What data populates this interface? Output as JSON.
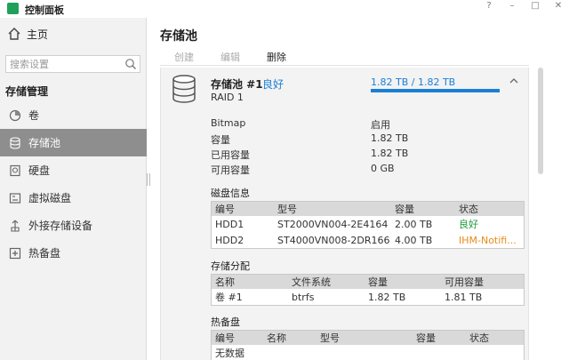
{
  "window": {
    "title": "控制面板",
    "help": "?",
    "minimize": "–",
    "maximize": "□",
    "close": "✕"
  },
  "sidebar": {
    "home_label": "主页",
    "search_placeholder": "搜索设置",
    "section_title": "存储管理",
    "items": [
      {
        "label": "卷"
      },
      {
        "label": "存储池",
        "active": true
      },
      {
        "label": "硬盘"
      },
      {
        "label": "虚拟磁盘"
      },
      {
        "label": "外接存储设备"
      },
      {
        "label": "热备盘"
      }
    ]
  },
  "main": {
    "title": "存储池",
    "toolbar": {
      "create": "创建",
      "edit": "编辑",
      "delete": "删除"
    },
    "pool": {
      "name": "存储池 #1",
      "status": "良好",
      "raid": "RAID 1",
      "capacity_text": "1.82 TB / 1.82 TB",
      "capacity_used_fraction": 1.0
    },
    "properties": [
      {
        "key": "Bitmap",
        "value": "启用"
      },
      {
        "key": "容量",
        "value": "1.82 TB"
      },
      {
        "key": "已用容量",
        "value": "1.82 TB"
      },
      {
        "key": "可用容量",
        "value": "0 GB"
      }
    ],
    "disk_info": {
      "title": "磁盘信息",
      "headers": [
        "编号",
        "型号",
        "容量",
        "状态"
      ],
      "rows": [
        [
          "HDD1",
          "ST2000VN004-2E4164",
          "2.00 TB",
          "良好"
        ],
        [
          "HDD2",
          "ST4000VN008-2DR166",
          "4.00 TB",
          "IHM-Notifi..."
        ]
      ]
    },
    "allocation": {
      "title": "存储分配",
      "headers": [
        "名称",
        "文件系统",
        "容量",
        "可用容量"
      ],
      "rows": [
        [
          "卷 #1",
          "btrfs",
          "1.82 TB",
          "1.81 TB"
        ]
      ]
    },
    "hotspare": {
      "title": "热备盘",
      "headers": [
        "编号",
        "名称",
        "型号",
        "容量",
        "状态"
      ],
      "empty": "无数据"
    }
  },
  "colors": {
    "accent": "#1a7fd4",
    "good": "#1f9a3a",
    "warning": "#e58b1a",
    "sidebar_active": "#8e8e8e"
  }
}
